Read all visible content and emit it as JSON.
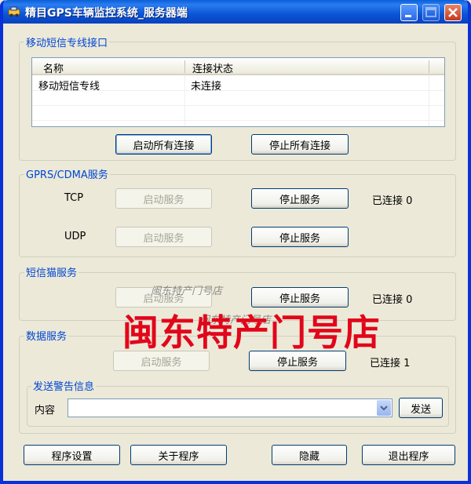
{
  "window": {
    "title": "精目GPS车辆监控系统_服务器端"
  },
  "sms_line": {
    "group_label": "移动短信专线接口",
    "columns": [
      "名称",
      "连接状态"
    ],
    "rows": [
      {
        "name": "移动短信专线",
        "status": "未连接"
      }
    ],
    "start_all_label": "启动所有连接",
    "stop_all_label": "停止所有连接"
  },
  "gprs": {
    "group_label": "GPRS/CDMA服务",
    "tcp": {
      "label": "TCP",
      "start_label": "启动服务",
      "stop_label": "停止服务",
      "status": "已连接 0"
    },
    "udp": {
      "label": "UDP",
      "start_label": "启动服务",
      "stop_label": "停止服务"
    }
  },
  "sms_cat": {
    "group_label": "短信猫服务",
    "start_label": "启动服务",
    "stop_label": "停止服务",
    "status": "已连接 0"
  },
  "data_service": {
    "group_label": "数据服务",
    "start_label": "启动服务",
    "stop_label": "停止服务",
    "status": "已连接 1"
  },
  "alert": {
    "group_label": "发送警告信息",
    "content_label": "内容",
    "content_value": "",
    "send_label": "发送"
  },
  "bottom": {
    "settings_label": "程序设置",
    "about_label": "关于程序",
    "hide_label": "隐藏",
    "exit_label": "退出程序"
  },
  "watermark": {
    "big_text": "闽东特产门号店",
    "small_text_1": "闽东特产门号店",
    "small_text_2": "闽东特产门号店"
  },
  "colors": {
    "titlebar": "#0b55d5",
    "group_label": "#0046d5",
    "watermark": "#e2061b"
  }
}
